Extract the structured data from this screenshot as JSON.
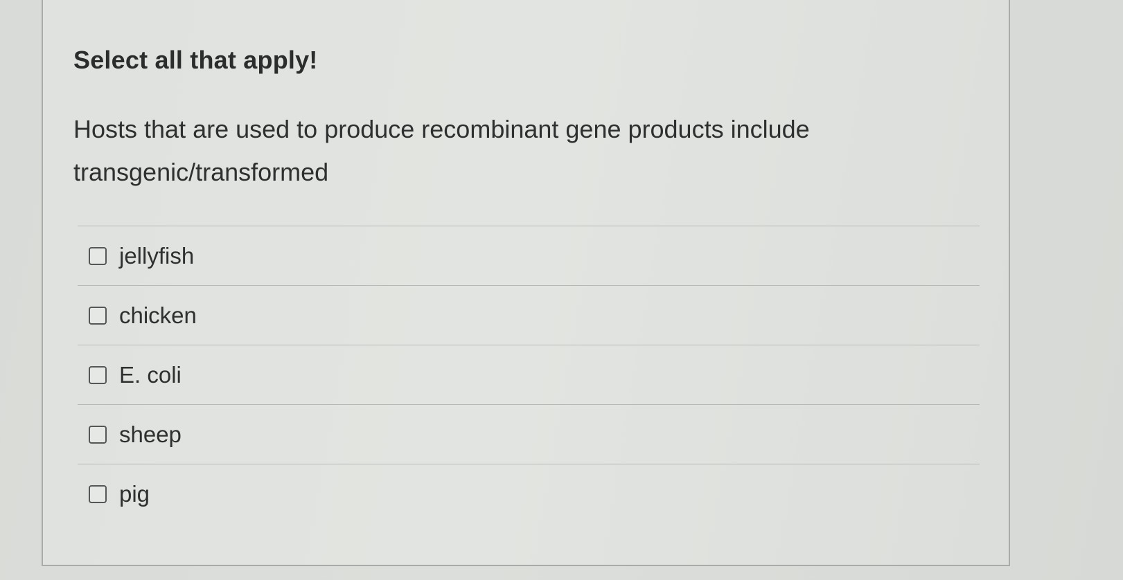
{
  "question": {
    "instruction": "Select all that apply!",
    "prompt": "Hosts that are used to produce recombinant gene products include transgenic/transformed"
  },
  "options": [
    {
      "label": "jellyfish",
      "checked": false
    },
    {
      "label": "chicken",
      "checked": false
    },
    {
      "label": "E. coli",
      "checked": false
    },
    {
      "label": "sheep",
      "checked": false
    },
    {
      "label": "pig",
      "checked": false
    }
  ],
  "colors": {
    "background": "#dadcd9",
    "card_border": "#a9aba8",
    "text": "#2e302f",
    "divider": "#b7b9b6"
  }
}
